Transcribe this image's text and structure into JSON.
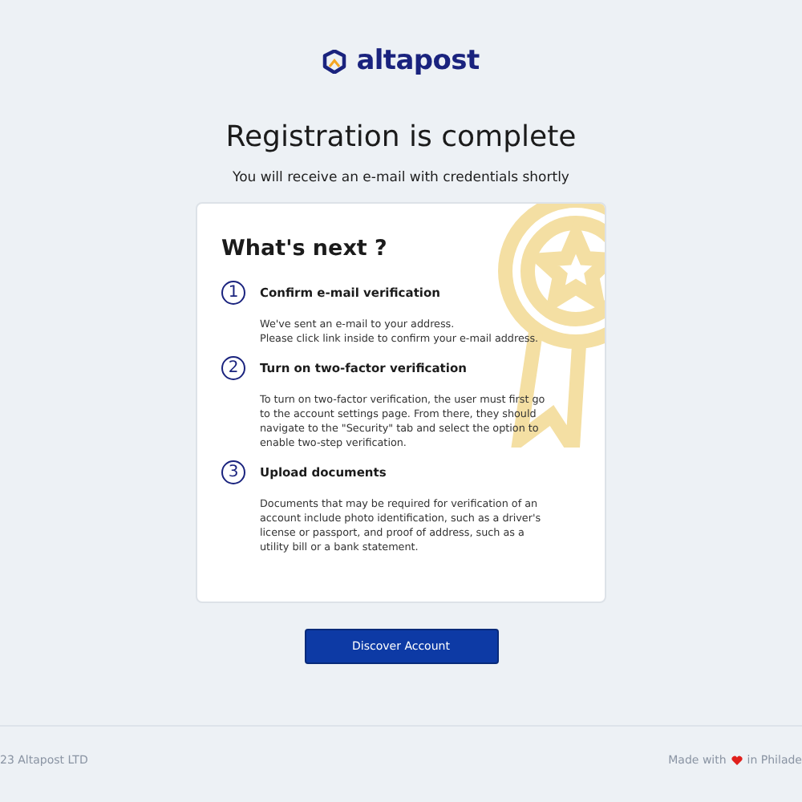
{
  "brand": "altapost",
  "title": "Registration is complete",
  "subtitle": "You will receive an e-mail with credentials shortly",
  "card": {
    "heading": "What's next ?",
    "steps": [
      {
        "number": "1",
        "title": "Confirm e-mail verification",
        "lines": [
          "We've sent an e-mail to your address.",
          "Please click link inside to confirm your e-mail address."
        ]
      },
      {
        "number": "2",
        "title": "Turn on two-factor verification",
        "lines": [
          "To turn on two-factor verification, the user must first go",
          "to the account settings page. From there, they should",
          "navigate to the \"Security\" tab and select the option to",
          "enable two-step verification."
        ]
      },
      {
        "number": "3",
        "title": "Upload documents",
        "lines": [
          "Documents that may be required for verification of an",
          "account include photo identification, such as a driver's",
          "license or passport, and proof of address, such as a",
          "utility bill or a bank statement."
        ]
      }
    ]
  },
  "button": "Discover Account",
  "footer": {
    "copyright": "23 Altapost LTD",
    "made_with": "Made with",
    "location": "in Philade"
  }
}
